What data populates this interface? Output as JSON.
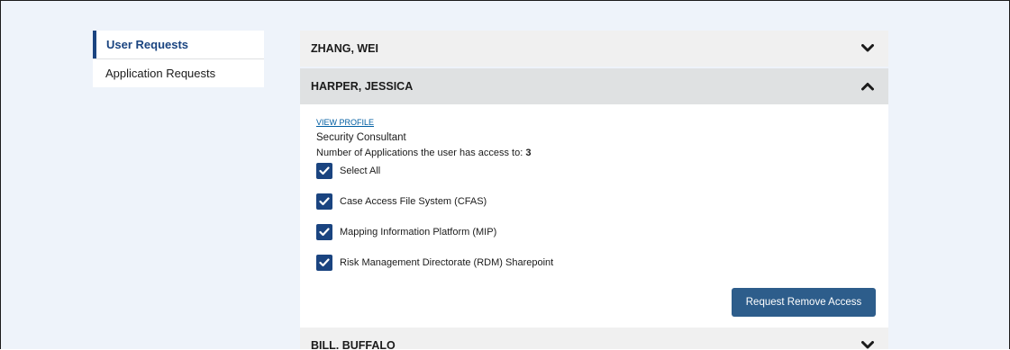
{
  "sidenav": {
    "items": [
      {
        "label": "User Requests",
        "active": true
      },
      {
        "label": "Application Requests",
        "active": false
      }
    ]
  },
  "accordion": {
    "items": [
      {
        "name": "ZHANG, WEI",
        "expanded": false,
        "chevron": "chevron-down-icon"
      },
      {
        "name": "HARPER, JESSICA",
        "expanded": true,
        "chevron": "chevron-up-icon",
        "view_profile": "VIEW PROFILE",
        "role": "Security Consultant",
        "app_count_label": "Number of Applications the user has access to:",
        "app_count_value": "3",
        "checkboxes": [
          {
            "label": "Select All",
            "checked": true
          },
          {
            "label": "Case Access File System (CFAS)",
            "checked": true
          },
          {
            "label": "Mapping Information Platform (MIP)",
            "checked": true
          },
          {
            "label": "Risk Management Directorate (RDM) Sharepoint",
            "checked": true
          }
        ],
        "action_button": "Request Remove Access"
      },
      {
        "name": "BILL, BUFFALO",
        "expanded": false,
        "chevron": "chevron-down-icon"
      }
    ]
  },
  "colors": {
    "page_background": "#eef3fa",
    "accent": "#1a4480",
    "button": "#2d5d8b",
    "link": "#005ea2",
    "header_background": "#f0f0f0",
    "open_header_background": "#dfe1e2"
  }
}
